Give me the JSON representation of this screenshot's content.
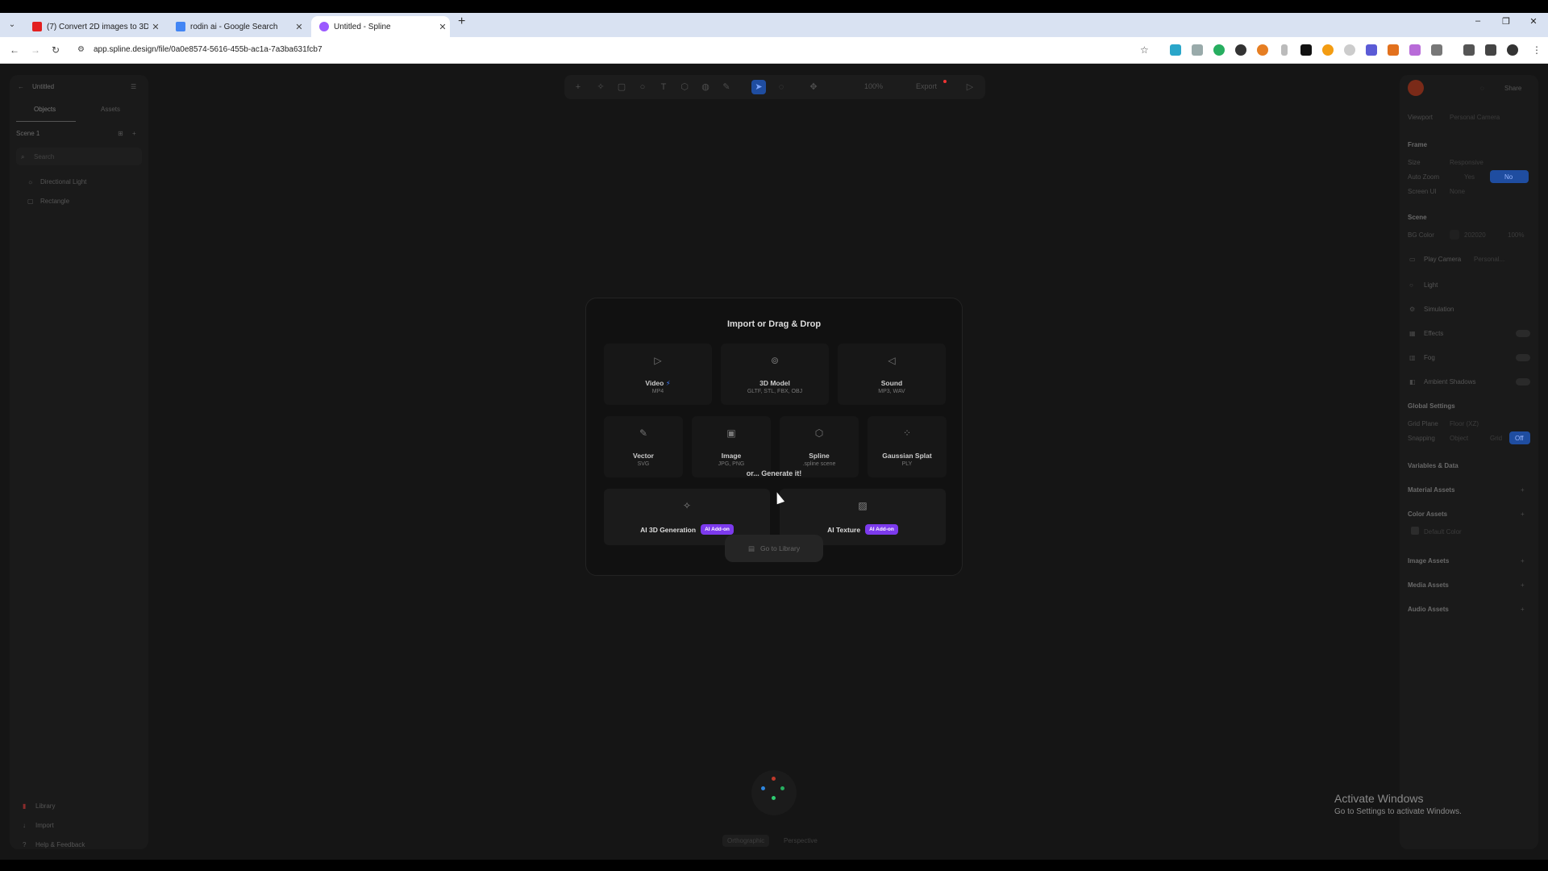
{
  "browser": {
    "tabs": [
      {
        "label": "(7) Convert 2D images to 3D m",
        "favicon_color": "#e32020"
      },
      {
        "label": "rodin ai - Google Search",
        "favicon_color": "#4285f4"
      },
      {
        "label": "Untitled - Spline",
        "favicon_color": "#9b59ff"
      }
    ],
    "new_tab": "+",
    "url": "app.spline.design/file/0a0e8574-5616-455b-ac1a-7a3ba631fcb7",
    "window_controls": [
      "–",
      "❐",
      "✕"
    ]
  },
  "left_panel": {
    "file_name": "Untitled",
    "tabs": [
      "Objects",
      "Assets"
    ],
    "scene_label": "Scene 1",
    "search_placeholder": "Search",
    "objects": [
      "Directional Light",
      "Rectangle"
    ],
    "footer": [
      "Library",
      "Import",
      "Help & Feedback"
    ]
  },
  "toolbar": {
    "zoom": "100%",
    "export_label": "Export"
  },
  "modal": {
    "title": "Import or Drag & Drop",
    "import_options": [
      {
        "label": "Video",
        "sub": "MP4",
        "icon": "play-icon"
      },
      {
        "label": "3D Model",
        "sub": "GLTF, STL, FBX, OBJ",
        "icon": "model-icon"
      },
      {
        "label": "Sound",
        "sub": "MP3, WAV",
        "icon": "sound-icon"
      },
      {
        "label": "Vector",
        "sub": "SVG",
        "icon": "vector-icon"
      },
      {
        "label": "Image",
        "sub": "JPG, PNG",
        "icon": "image-icon"
      },
      {
        "label": "Spline",
        "sub": ".spline scene",
        "icon": "cube-icon"
      },
      {
        "label": "Gaussian Splat",
        "sub": "PLY",
        "icon": "splat-icon"
      }
    ],
    "generate_title": "or... Generate it!",
    "generate_options": [
      {
        "label": "AI 3D Generation",
        "badge": "AI Add-on",
        "icon": "sparkle-icon"
      },
      {
        "label": "AI Texture",
        "badge": "AI Add-on",
        "icon": "texture-icon"
      }
    ]
  },
  "library_button": "Go to Library",
  "camera_tabs": [
    "Orthographic",
    "Perspective"
  ],
  "right_panel": {
    "share_label": "Share",
    "viewport_label": "Viewport",
    "viewport_value": "Personal Camera",
    "frame_head": "Frame",
    "size_label": "Size",
    "size_value": "Responsive",
    "autozoom_label": "Auto Zoom",
    "autozoom_yes": "Yes",
    "autozoom_no": "No",
    "screenui_label": "Screen UI",
    "screenui_value": "None",
    "scene_head": "Scene",
    "bgcolor_label": "BG Color",
    "bgcolor_hex": "202020",
    "bgcolor_opacity": "100%",
    "play_camera_label": "Play Camera",
    "play_camera_value": "Personal...",
    "light": "Light",
    "simulation": "Simulation",
    "effects": "Effects",
    "fog": "Fog",
    "ambient_shadows": "Ambient Shadows",
    "global_settings_head": "Global Settings",
    "grid_plane_label": "Grid Plane",
    "grid_plane_value": "Floor (XZ)",
    "snapping_label": "Snapping",
    "snapping_object": "Object",
    "snapping_grid": "Grid",
    "snapping_off": "Off",
    "sections": [
      "Variables & Data",
      "Material Assets",
      "Color Assets"
    ],
    "default_color": "Default Color",
    "sections2": [
      "Image Assets",
      "Media Assets",
      "Audio Assets"
    ]
  },
  "windows_watermark": {
    "title": "Activate Windows",
    "subtitle": "Go to Settings to activate Windows."
  }
}
